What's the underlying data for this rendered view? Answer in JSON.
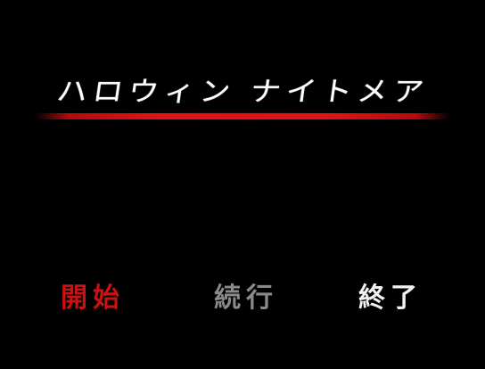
{
  "title": {
    "text": "ハロウィン ナイトメア",
    "underline_color": "#e11414"
  },
  "menu": [
    {
      "label": "開始",
      "color": "#cc1111",
      "selected": true
    },
    {
      "label": "続行",
      "color": "#8a8a8a",
      "selected": false
    },
    {
      "label": "終了",
      "color": "#f2f2f2",
      "selected": false
    }
  ]
}
